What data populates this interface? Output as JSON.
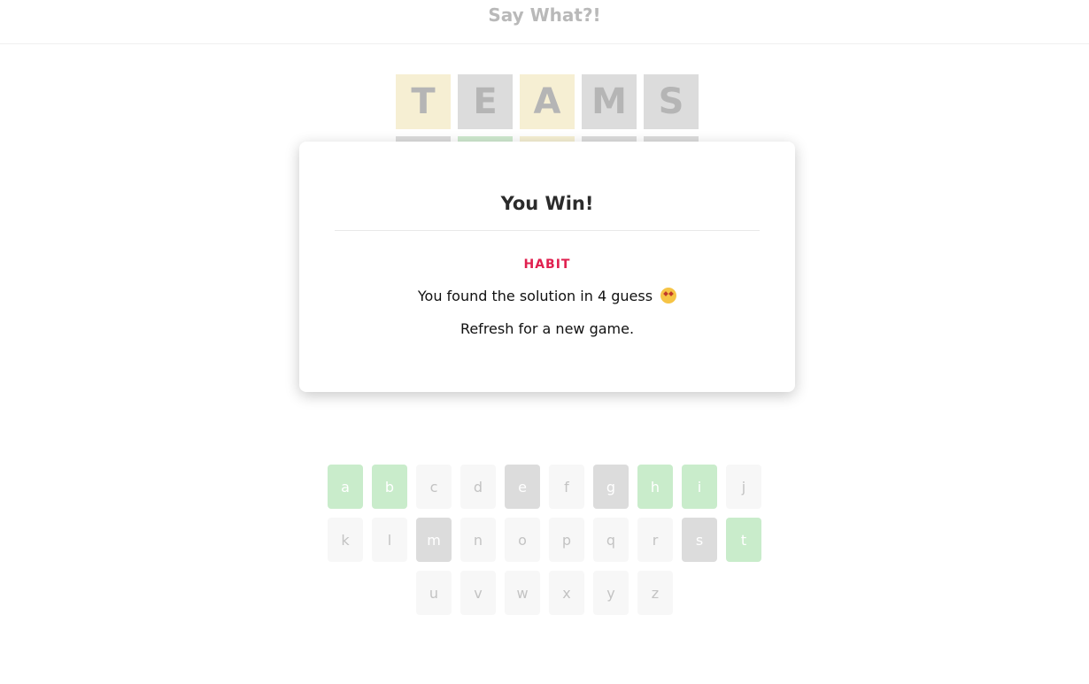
{
  "header": {
    "title": "Say What?!"
  },
  "grid": {
    "rows": [
      [
        {
          "letter": "T",
          "state": "present"
        },
        {
          "letter": "E",
          "state": "absent"
        },
        {
          "letter": "A",
          "state": "present"
        },
        {
          "letter": "M",
          "state": "absent"
        },
        {
          "letter": "S",
          "state": "absent"
        }
      ],
      [
        {
          "letter": "",
          "state": "absent"
        },
        {
          "letter": "",
          "state": "correct"
        },
        {
          "letter": "",
          "state": "present"
        },
        {
          "letter": "",
          "state": "absent"
        },
        {
          "letter": "",
          "state": "absent"
        }
      ],
      [
        {
          "letter": "",
          "state": "empty"
        },
        {
          "letter": "",
          "state": "empty"
        },
        {
          "letter": "",
          "state": "empty"
        },
        {
          "letter": "",
          "state": "empty"
        },
        {
          "letter": "",
          "state": "empty"
        }
      ]
    ]
  },
  "modal": {
    "title": "You Win!",
    "solution": "HABIT",
    "message": "You found the solution in 4 guess",
    "emoji": "star-struck-emoji",
    "refresh": "Refresh for a new game."
  },
  "keyboard": {
    "rows": [
      [
        {
          "key": "a",
          "state": "correct"
        },
        {
          "key": "b",
          "state": "correct"
        },
        {
          "key": "c",
          "state": "unused"
        },
        {
          "key": "d",
          "state": "unused"
        },
        {
          "key": "e",
          "state": "absent"
        },
        {
          "key": "f",
          "state": "unused"
        },
        {
          "key": "g",
          "state": "absent"
        },
        {
          "key": "h",
          "state": "correct"
        },
        {
          "key": "i",
          "state": "correct"
        },
        {
          "key": "j",
          "state": "unused"
        }
      ],
      [
        {
          "key": "k",
          "state": "unused"
        },
        {
          "key": "l",
          "state": "unused"
        },
        {
          "key": "m",
          "state": "absent"
        },
        {
          "key": "n",
          "state": "unused"
        },
        {
          "key": "o",
          "state": "unused"
        },
        {
          "key": "p",
          "state": "unused"
        },
        {
          "key": "q",
          "state": "unused"
        },
        {
          "key": "r",
          "state": "unused"
        },
        {
          "key": "s",
          "state": "absent"
        },
        {
          "key": "t",
          "state": "correct"
        }
      ],
      [
        {
          "key": "u",
          "state": "unused"
        },
        {
          "key": "v",
          "state": "unused"
        },
        {
          "key": "w",
          "state": "unused"
        },
        {
          "key": "x",
          "state": "unused"
        },
        {
          "key": "y",
          "state": "unused"
        },
        {
          "key": "z",
          "state": "unused"
        }
      ]
    ]
  },
  "colors": {
    "present": "#f6efd3",
    "absent": "#dcdcdc",
    "correct": "#cfe9cf",
    "solution": "#e0204f"
  }
}
